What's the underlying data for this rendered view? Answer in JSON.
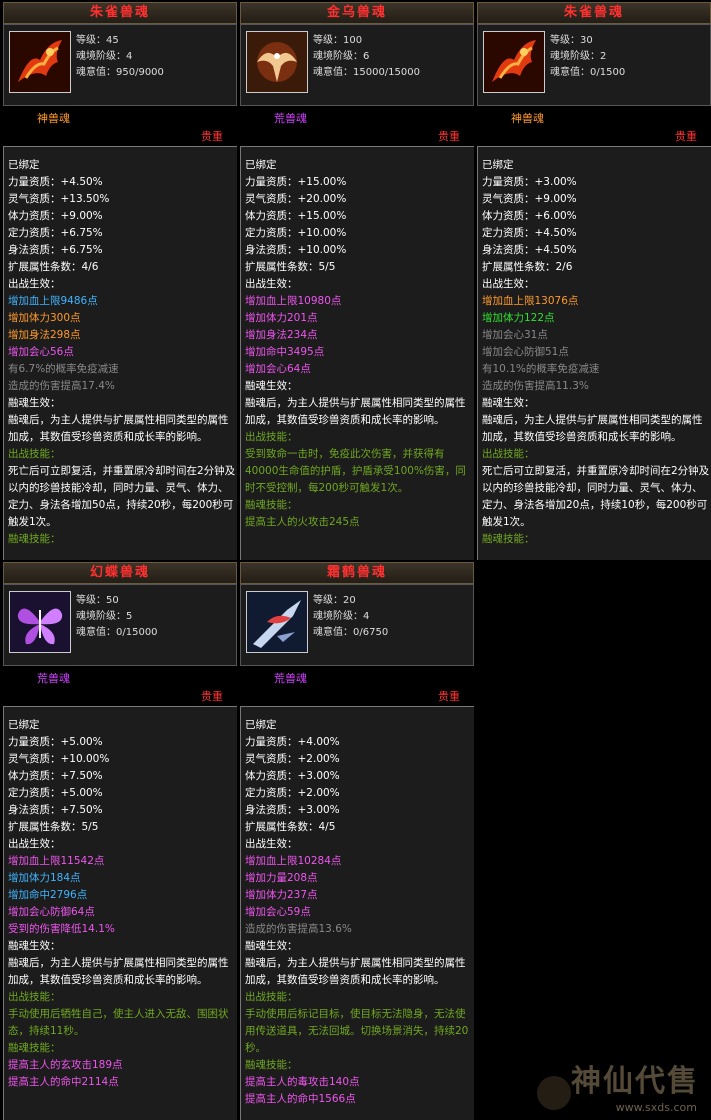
{
  "cards": [
    {
      "title": "朱雀兽魂",
      "level": "等级：45",
      "stage": "魂境阶级：4",
      "soul": "魂意值：950/9000",
      "kind": "神兽魂",
      "grade": "贵重",
      "lines": [
        {
          "t": "已绑定",
          "c": "w"
        },
        {
          "t": "力量资质：+4.50%",
          "c": "w"
        },
        {
          "t": "灵气资质：+13.50%",
          "c": "w"
        },
        {
          "t": "体力资质：+9.00%",
          "c": "w"
        },
        {
          "t": "定力资质：+6.75%",
          "c": "w"
        },
        {
          "t": "身法资质：+6.75%",
          "c": "w"
        },
        {
          "t": "扩展属性条数：4/6",
          "c": "w"
        },
        {
          "t": "出战生效：",
          "c": "w"
        },
        {
          "t": "增加血上限9486点",
          "c": "blue"
        },
        {
          "t": "增加体力300点",
          "c": "orange"
        },
        {
          "t": "增加身法298点",
          "c": "orange"
        },
        {
          "t": "增加会心56点",
          "c": "purple"
        },
        {
          "t": "有6.7%的概率免疫减速",
          "c": "gray"
        },
        {
          "t": "造成的伤害提高17.4%",
          "c": "gray"
        },
        {
          "t": "融魂生效：",
          "c": "w"
        },
        {
          "t": "融魂后，为主人提供与扩展属性相同类型的属性加成，其数值受珍兽资质和成长率的影响。",
          "c": "w",
          "wrap": true
        },
        {
          "t": "出战技能：",
          "c": "olive"
        },
        {
          "t": "死亡后可立即复活，并重置原冷却时间在2分钟及以内的珍兽技能冷却，同时力量、灵气、体力、定力、身法各增加50点，持续20秒，每200秒可触发1次。",
          "c": "w",
          "wrap": true
        },
        {
          "t": "融魂技能：",
          "c": "olive"
        }
      ]
    },
    {
      "title": "金乌兽魂",
      "level": "等级：100",
      "stage": "魂境阶级：6",
      "soul": "魂意值：15000/15000",
      "kind": "荒兽魂",
      "grade": "贵重",
      "lines": [
        {
          "t": "已绑定",
          "c": "w"
        },
        {
          "t": "力量资质：+15.00%",
          "c": "w"
        },
        {
          "t": "灵气资质：+20.00%",
          "c": "w"
        },
        {
          "t": "体力资质：+15.00%",
          "c": "w"
        },
        {
          "t": "定力资质：+10.00%",
          "c": "w"
        },
        {
          "t": "身法资质：+10.00%",
          "c": "w"
        },
        {
          "t": "扩展属性条数：5/5",
          "c": "w"
        },
        {
          "t": "出战生效：",
          "c": "w"
        },
        {
          "t": "增加血上限10980点",
          "c": "purple"
        },
        {
          "t": "增加体力201点",
          "c": "purple"
        },
        {
          "t": "增加身法234点",
          "c": "purple"
        },
        {
          "t": "增加命中3495点",
          "c": "purple"
        },
        {
          "t": "增加会心64点",
          "c": "purple"
        },
        {
          "t": "融魂生效：",
          "c": "w"
        },
        {
          "t": "融魂后，为主人提供与扩展属性相同类型的属性加成，其数值受珍兽资质和成长率的影响。",
          "c": "w",
          "wrap": true
        },
        {
          "t": "出战技能：",
          "c": "olive"
        },
        {
          "t": "受到致命一击时，免疫此次伤害，并获得有40000生命值的护盾，护盾承受100%伤害，同时不受控制，每200秒可触发1次。",
          "c": "olive",
          "wrap": true
        },
        {
          "t": "融魂技能：",
          "c": "olive"
        },
        {
          "t": "提高主人的火攻击245点",
          "c": "olive"
        }
      ]
    },
    {
      "title": "朱雀兽魂",
      "level": "等级：30",
      "stage": "魂境阶级：2",
      "soul": "魂意值：0/1500",
      "kind": "神兽魂",
      "grade": "贵重",
      "lines": [
        {
          "t": "已绑定",
          "c": "w"
        },
        {
          "t": "力量资质：+3.00%",
          "c": "w"
        },
        {
          "t": "灵气资质：+9.00%",
          "c": "w"
        },
        {
          "t": "体力资质：+6.00%",
          "c": "w"
        },
        {
          "t": "定力资质：+4.50%",
          "c": "w"
        },
        {
          "t": "身法资质：+4.50%",
          "c": "w"
        },
        {
          "t": "扩展属性条数：2/6",
          "c": "w"
        },
        {
          "t": "出战生效：",
          "c": "w"
        },
        {
          "t": "增加血上限13076点",
          "c": "orange"
        },
        {
          "t": "增加体力122点",
          "c": "green"
        },
        {
          "t": "增加会心31点",
          "c": "gray"
        },
        {
          "t": "增加会心防御51点",
          "c": "gray"
        },
        {
          "t": "有10.1%的概率免疫减速",
          "c": "gray"
        },
        {
          "t": "造成的伤害提高11.3%",
          "c": "gray"
        },
        {
          "t": "融魂生效：",
          "c": "w"
        },
        {
          "t": "融魂后，为主人提供与扩展属性相同类型的属性加成，其数值受珍兽资质和成长率的影响。",
          "c": "w",
          "wrap": true
        },
        {
          "t": "出战技能：",
          "c": "olive"
        },
        {
          "t": "死亡后可立即复活，并重置原冷却时间在2分钟及以内的珍兽技能冷却，同时力量、灵气、体力、定力、身法各增加20点，持续10秒，每200秒可触发1次。",
          "c": "w",
          "wrap": true
        },
        {
          "t": "融魂技能：",
          "c": "olive"
        }
      ]
    },
    {
      "title": "幻蝶兽魂",
      "level": "等级：50",
      "stage": "魂境阶级：5",
      "soul": "魂意值：0/15000",
      "kind": "荒兽魂",
      "grade": "贵重",
      "lines": [
        {
          "t": "已绑定",
          "c": "w"
        },
        {
          "t": "力量资质：+5.00%",
          "c": "w"
        },
        {
          "t": "灵气资质：+10.00%",
          "c": "w"
        },
        {
          "t": "体力资质：+7.50%",
          "c": "w"
        },
        {
          "t": "定力资质：+5.00%",
          "c": "w"
        },
        {
          "t": "身法资质：+7.50%",
          "c": "w"
        },
        {
          "t": "扩展属性条数：5/5",
          "c": "w"
        },
        {
          "t": "出战生效：",
          "c": "w"
        },
        {
          "t": "增加血上限11542点",
          "c": "purple"
        },
        {
          "t": "增加体力184点",
          "c": "blue"
        },
        {
          "t": "增加命中2796点",
          "c": "blue"
        },
        {
          "t": "增加会心防御64点",
          "c": "purple"
        },
        {
          "t": "受到的伤害降低14.1%",
          "c": "purple"
        },
        {
          "t": "融魂生效：",
          "c": "w"
        },
        {
          "t": "融魂后，为主人提供与扩展属性相同类型的属性加成，其数值受珍兽资质和成长率的影响。",
          "c": "w",
          "wrap": true
        },
        {
          "t": "出战技能：",
          "c": "olive"
        },
        {
          "t": "手动使用后牺牲自己，使主人进入无敌、围困状态，持续11秒。",
          "c": "olive",
          "wrap": true
        },
        {
          "t": "融魂技能：",
          "c": "olive"
        },
        {
          "t": "提高主人的玄攻击189点",
          "c": "purple"
        },
        {
          "t": "提高主人的命中2114点",
          "c": "purple"
        }
      ]
    },
    {
      "title": "霜鹤兽魂",
      "level": "等级：20",
      "stage": "魂境阶级：4",
      "soul": "魂意值：0/6750",
      "kind": "荒兽魂",
      "grade": "贵重",
      "lines": [
        {
          "t": "已绑定",
          "c": "w"
        },
        {
          "t": "力量资质：+4.00%",
          "c": "w"
        },
        {
          "t": "灵气资质：+2.00%",
          "c": "w"
        },
        {
          "t": "体力资质：+3.00%",
          "c": "w"
        },
        {
          "t": "定力资质：+2.00%",
          "c": "w"
        },
        {
          "t": "身法资质：+3.00%",
          "c": "w"
        },
        {
          "t": "扩展属性条数：4/5",
          "c": "w"
        },
        {
          "t": "出战生效：",
          "c": "w"
        },
        {
          "t": "增加血上限10284点",
          "c": "purple"
        },
        {
          "t": "增加力量208点",
          "c": "purple"
        },
        {
          "t": "增加体力237点",
          "c": "purple"
        },
        {
          "t": "增加会心59点",
          "c": "purple"
        },
        {
          "t": "造成的伤害提高13.6%",
          "c": "gray"
        },
        {
          "t": "融魂生效：",
          "c": "w"
        },
        {
          "t": "融魂后，为主人提供与扩展属性相同类型的属性加成，其数值受珍兽资质和成长率的影响。",
          "c": "w",
          "wrap": true
        },
        {
          "t": "出战技能：",
          "c": "olive"
        },
        {
          "t": "手动使用后标记目标，使目标无法隐身，无法使用传送道具，无法回城。切换场景消失，持续20秒。",
          "c": "olive",
          "wrap": true
        },
        {
          "t": "融魂技能：",
          "c": "olive"
        },
        {
          "t": "提高主人的毒攻击140点",
          "c": "purple"
        },
        {
          "t": "提高主人的命中1566点",
          "c": "purple"
        }
      ]
    }
  ],
  "kind_colors": [
    "#ff9a2a",
    "#d040ff",
    "#ff9a2a",
    "#d040ff",
    "#d040ff"
  ],
  "icons": [
    "phoenix-red-icon",
    "golden-crow-icon",
    "phoenix-red-icon",
    "butterfly-icon",
    "frost-crane-icon"
  ],
  "watermark": {
    "title": "神仙代售",
    "url": "www.sxds.com"
  }
}
